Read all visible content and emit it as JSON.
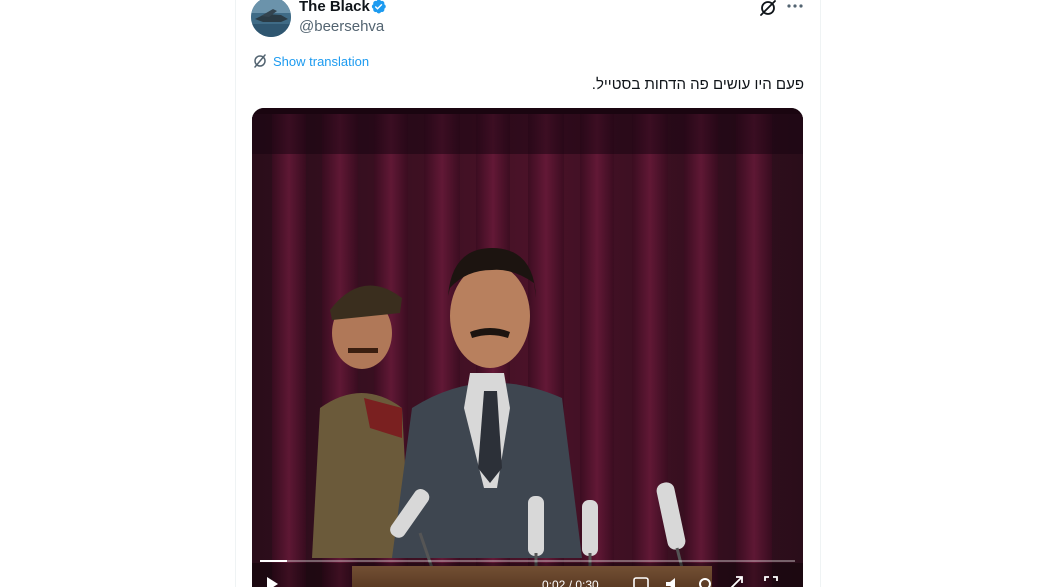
{
  "tweet": {
    "author_name": "The Black",
    "handle": "@beersehva",
    "translate_label": "Show translation",
    "text": "פעם היו עושים פה הדחות בסטייל."
  },
  "video": {
    "progress": 0.05,
    "time": "0:02 / 0:30"
  },
  "icons": {
    "verified": "verified-badge-icon",
    "grok": "grok-icon",
    "more": "more-icon",
    "translate": "translate-icon",
    "play": "play-icon"
  },
  "colors": {
    "accent": "#1d9bf0",
    "text": "#0f1419",
    "secondary": "#536471"
  }
}
